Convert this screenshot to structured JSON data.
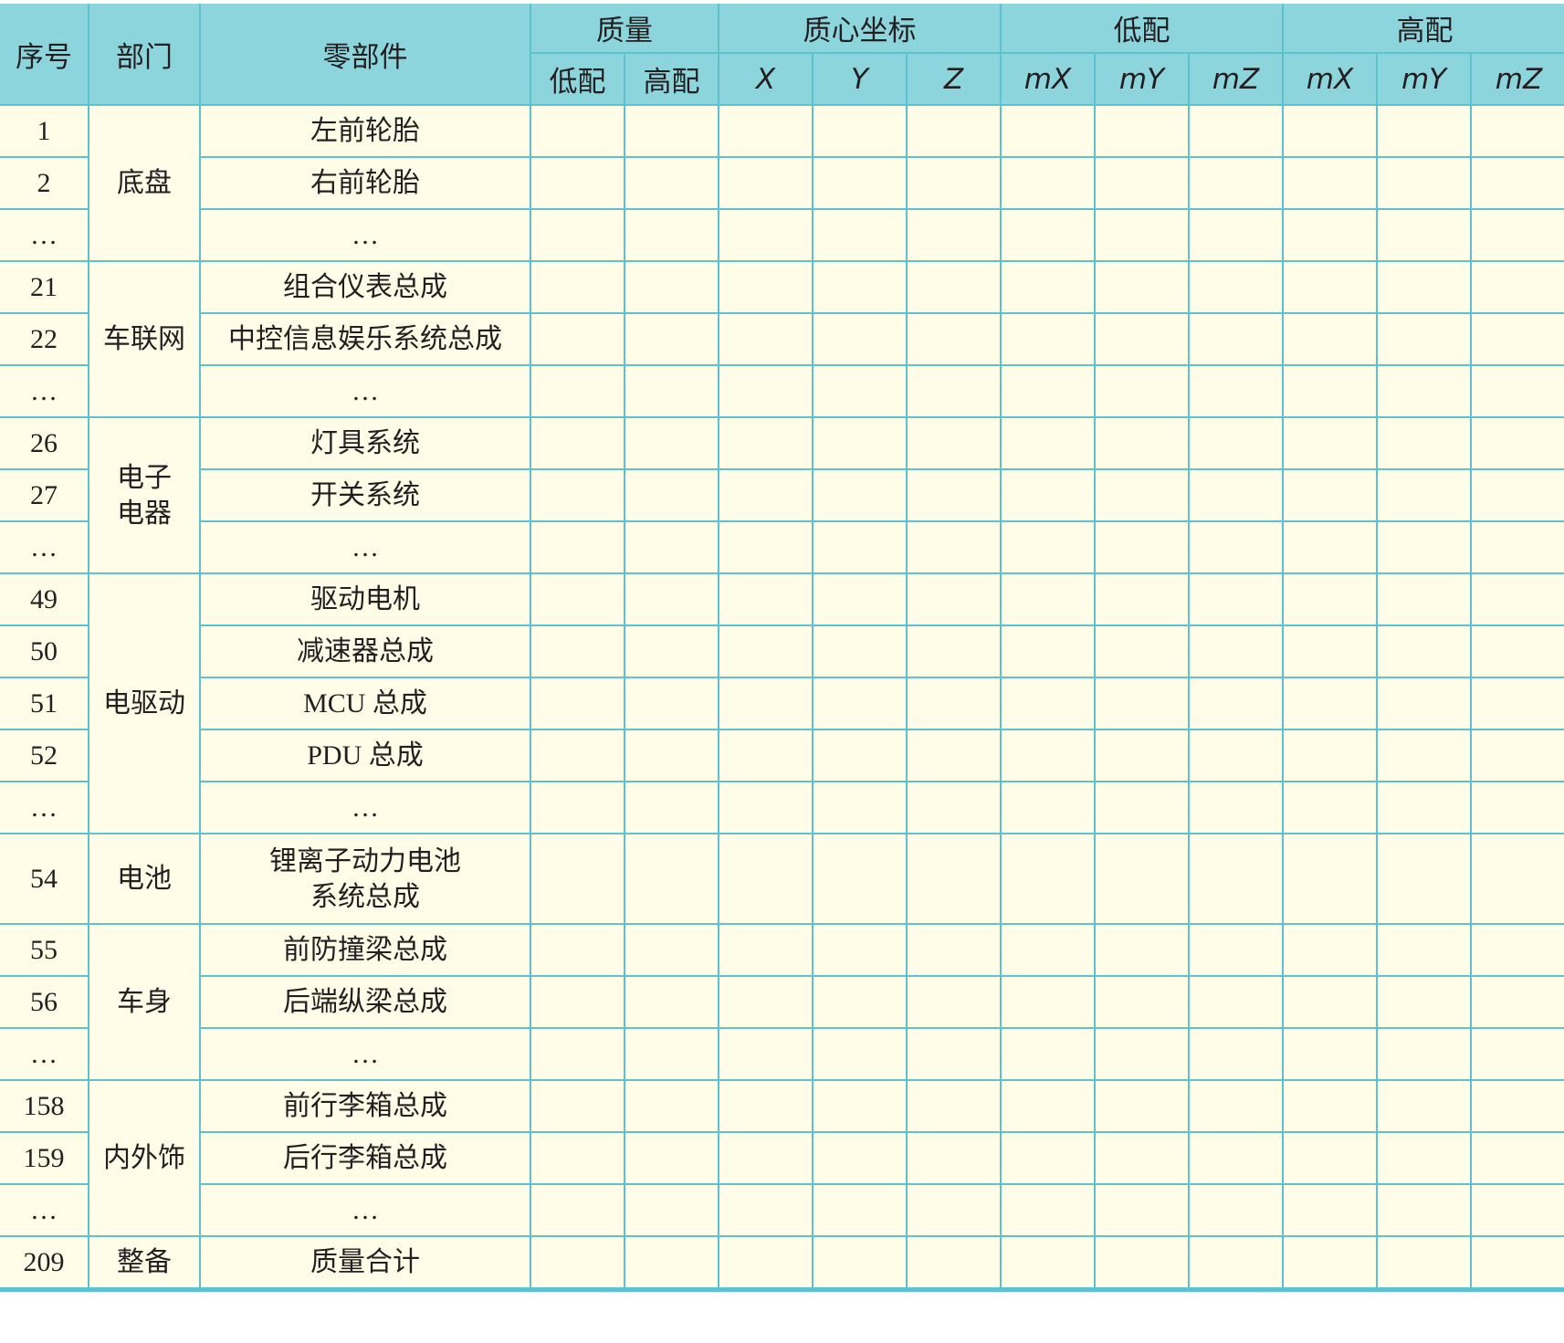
{
  "header": {
    "seq": "序号",
    "dept": "部门",
    "part": "零部件",
    "mass": "质量",
    "mass_sub": [
      "低配",
      "高配"
    ],
    "cog": "质心坐标",
    "cog_sub": [
      "X",
      "Y",
      "Z"
    ],
    "low": "低配",
    "low_sub": [
      "mX",
      "mY",
      "mZ"
    ],
    "high": "高配",
    "high_sub": [
      "mX",
      "mY",
      "mZ"
    ]
  },
  "groups": [
    {
      "dept": "底盘",
      "rows": [
        {
          "seq": "1",
          "part": "左前轮胎"
        },
        {
          "seq": "2",
          "part": "右前轮胎"
        },
        {
          "seq": "…",
          "part": "…"
        }
      ]
    },
    {
      "dept": "车联网",
      "rows": [
        {
          "seq": "21",
          "part": "组合仪表总成"
        },
        {
          "seq": "22",
          "part": "中控信息娱乐系统总成"
        },
        {
          "seq": "…",
          "part": "…"
        }
      ]
    },
    {
      "dept": "电子\n电器",
      "rows": [
        {
          "seq": "26",
          "part": "灯具系统"
        },
        {
          "seq": "27",
          "part": "开关系统"
        },
        {
          "seq": "…",
          "part": "…"
        }
      ]
    },
    {
      "dept": "电驱动",
      "rows": [
        {
          "seq": "49",
          "part": "驱动电机"
        },
        {
          "seq": "50",
          "part": "减速器总成"
        },
        {
          "seq": "51",
          "part": "MCU 总成"
        },
        {
          "seq": "52",
          "part": "PDU 总成"
        },
        {
          "seq": "…",
          "part": "…"
        }
      ]
    },
    {
      "dept": "电池",
      "rows": [
        {
          "seq": "54",
          "part": "锂离子动力电池\n系统总成"
        }
      ]
    },
    {
      "dept": "车身",
      "rows": [
        {
          "seq": "55",
          "part": "前防撞梁总成"
        },
        {
          "seq": "56",
          "part": "后端纵梁总成"
        },
        {
          "seq": "…",
          "part": "…"
        }
      ]
    },
    {
      "dept": "内外饰",
      "rows": [
        {
          "seq": "158",
          "part": "前行李箱总成"
        },
        {
          "seq": "159",
          "part": "后行李箱总成"
        },
        {
          "seq": "…",
          "part": "…"
        }
      ]
    },
    {
      "dept": "整备",
      "rows": [
        {
          "seq": "209",
          "part": "质量合计"
        }
      ]
    }
  ]
}
